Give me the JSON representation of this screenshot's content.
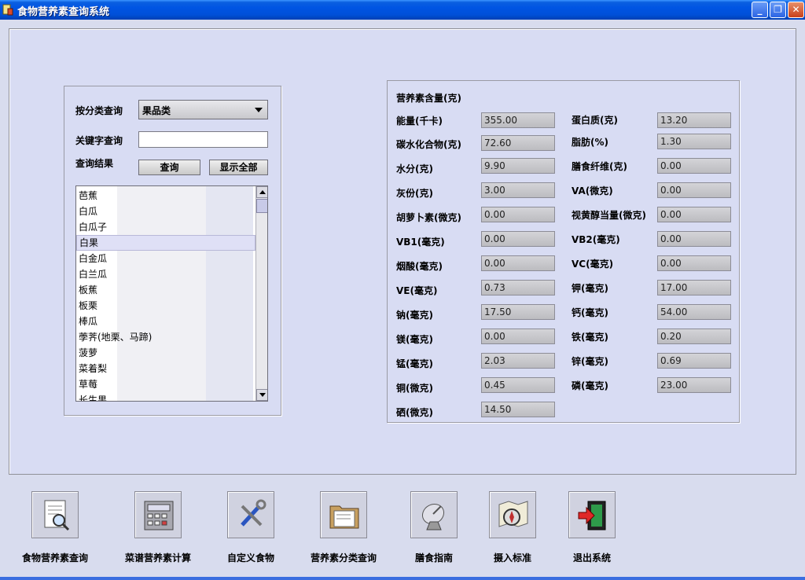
{
  "window": {
    "title": "食物营养素查询系统",
    "min_glyph": "_",
    "max_glyph": "❐",
    "close_glyph": "✕"
  },
  "query": {
    "category_label": "按分类查询",
    "category_value": "果品类",
    "keyword_label": "关键字查询",
    "keyword_value": "",
    "result_label": "查询结果",
    "query_button": "查询",
    "show_all_button": "显示全部",
    "results": [
      "芭蕉",
      "白瓜",
      "白瓜子",
      "白果",
      "白金瓜",
      "白兰瓜",
      "板蕉",
      "板栗",
      "棒瓜",
      "荸荠(地栗、马蹄)",
      "菠萝",
      "菜着梨",
      "草莓",
      "长生果"
    ],
    "selected_index": 3
  },
  "nutrients": {
    "title": "营养素含量(克)",
    "left": [
      {
        "label": "能量(千卡)",
        "value": "355.00"
      },
      {
        "label": "碳水化合物(克)",
        "value": "72.60"
      },
      {
        "label": "水分(克)",
        "value": "9.90"
      },
      {
        "label": "灰份(克)",
        "value": "3.00"
      },
      {
        "label": "胡萝卜素(微克)",
        "value": "0.00"
      },
      {
        "label": "VB1(毫克)",
        "value": "0.00"
      },
      {
        "label": "烟酸(毫克)",
        "value": "0.00"
      },
      {
        "label": "VE(毫克)",
        "value": "0.73"
      },
      {
        "label": "钠(毫克)",
        "value": "17.50"
      },
      {
        "label": "镁(毫克)",
        "value": "0.00"
      },
      {
        "label": "锰(毫克)",
        "value": "2.03"
      },
      {
        "label": "铜(微克)",
        "value": "0.45"
      },
      {
        "label": "硒(微克)",
        "value": "14.50"
      }
    ],
    "right": [
      {
        "label": "蛋白质(克)",
        "value": "13.20"
      },
      {
        "label": "脂肪(%)",
        "value": "1.30"
      },
      {
        "label": "膳食纤维(克)",
        "value": "0.00"
      },
      {
        "label": "VA(微克)",
        "value": "0.00"
      },
      {
        "label": "视黄醇当量(微克)",
        "value": "0.00"
      },
      {
        "label": "VB2(毫克)",
        "value": "0.00"
      },
      {
        "label": "VC(毫克)",
        "value": "0.00"
      },
      {
        "label": "钾(毫克)",
        "value": "17.00"
      },
      {
        "label": "钙(毫克)",
        "value": "54.00"
      },
      {
        "label": "铁(毫克)",
        "value": "0.20"
      },
      {
        "label": "锌(毫克)",
        "value": "0.69"
      },
      {
        "label": "磷(毫克)",
        "value": "23.00"
      }
    ]
  },
  "toolbar": {
    "items": [
      {
        "label": "食物营养素查询",
        "icon": "document-search-icon"
      },
      {
        "label": "菜谱营养素计算",
        "icon": "calculator-icon"
      },
      {
        "label": "自定义食物",
        "icon": "tools-icon"
      },
      {
        "label": "营养素分类查询",
        "icon": "folder-icon"
      },
      {
        "label": "膳食指南",
        "icon": "satellite-dish-icon"
      },
      {
        "label": "摄入标准",
        "icon": "compass-map-icon"
      },
      {
        "label": "退出系统",
        "icon": "exit-door-icon"
      }
    ]
  },
  "colors": {
    "titlebar": "#0054e3",
    "panel": "#d8dcf3",
    "selected_row": "#dfe0f6"
  }
}
